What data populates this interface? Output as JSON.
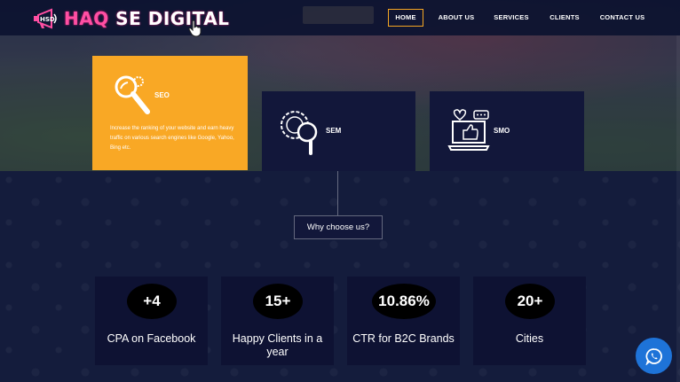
{
  "brand": {
    "name_part1": "HAQ",
    "name_part2": " SE DIGITAL"
  },
  "nav": {
    "items": [
      {
        "label": "HOME",
        "active": true
      },
      {
        "label": "ABOUT US",
        "active": false
      },
      {
        "label": "SERVICES",
        "active": false
      },
      {
        "label": "CLIENTS",
        "active": false
      },
      {
        "label": "CONTACT US",
        "active": false
      }
    ]
  },
  "services": [
    {
      "title": "SEO",
      "icon": "seo-magnifier-gear-icon",
      "description": "Increase the ranking of your website and earn heavy traffic on various search engines like Google, Yahoo, Bing etc."
    },
    {
      "title": "SEM",
      "icon": "sem-gear-magnifier-icon"
    },
    {
      "title": "SMO",
      "icon": "smo-laptop-like-icon"
    }
  ],
  "why_button": "Why choose us?",
  "stats": [
    {
      "value": "+4",
      "label": "CPA on Facebook"
    },
    {
      "value": "15+",
      "label": "Happy Clients in a year"
    },
    {
      "value": "10.86%",
      "label": "CTR for B2C Brands"
    },
    {
      "value": "20+",
      "label": "Cities"
    }
  ],
  "colors": {
    "accent": "#f9a825",
    "navy": "#141c3c",
    "card": "#12173a",
    "whatsapp": "#1e73d8"
  }
}
